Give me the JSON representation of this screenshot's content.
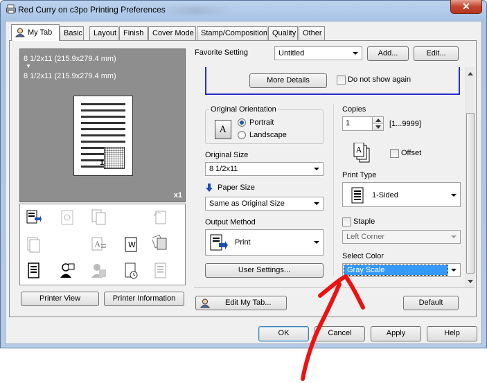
{
  "window": {
    "title": "Red Curry on c3po Printing Preferences",
    "close_glyph": "✕"
  },
  "tabs": [
    "My Tab",
    "Basic",
    "Layout",
    "Finish",
    "Cover Mode",
    "Stamp/Composition",
    "Quality",
    "Other"
  ],
  "preview": {
    "size_line1": "8 1/2x11 (215.9x279.4 mm)",
    "arrow_glyph": "▼",
    "size_line2": "8 1/2x11 (215.9x279.4 mm)",
    "copies_badge": "x1",
    "page_number": "1"
  },
  "left_buttons": {
    "printer_view": "Printer View",
    "printer_information": "Printer Information"
  },
  "favorite": {
    "label": "Favorite Setting",
    "value": "Untitled",
    "add_button": "Add...",
    "edit_button": "Edit..."
  },
  "notice": {
    "more_details_button": "More Details",
    "do_not_show_label": "Do not show again"
  },
  "original_orientation": {
    "label": "Original Orientation",
    "icon_letter": "A",
    "options": [
      "Portrait",
      "Landscape"
    ],
    "selected": "Portrait"
  },
  "original_size": {
    "label": "Original Size",
    "value": "8 1/2x11"
  },
  "paper_size": {
    "label": "Paper Size",
    "value": "Same as Original Size"
  },
  "output_method": {
    "label": "Output Method",
    "value": "Print"
  },
  "user_settings_button": "User Settings...",
  "copies": {
    "label": "Copies",
    "value": "1",
    "range": "[1...9999]"
  },
  "offset_label": "Offset",
  "print_type": {
    "label": "Print Type",
    "value": "1-Sided"
  },
  "staple": {
    "label": "Staple",
    "value": "Left Corner"
  },
  "select_color": {
    "label": "Select Color",
    "value": "Gray Scale"
  },
  "edit_my_tab_button": "Edit My Tab...",
  "default_button": "Default",
  "dialog_buttons": {
    "ok": "OK",
    "cancel": "Cancel",
    "apply": "Apply",
    "help": "Help"
  },
  "colors": {
    "selection_blue": "#3399ff",
    "accent_blue": "#1a4fb5",
    "annotation_red": "#ee1111"
  }
}
